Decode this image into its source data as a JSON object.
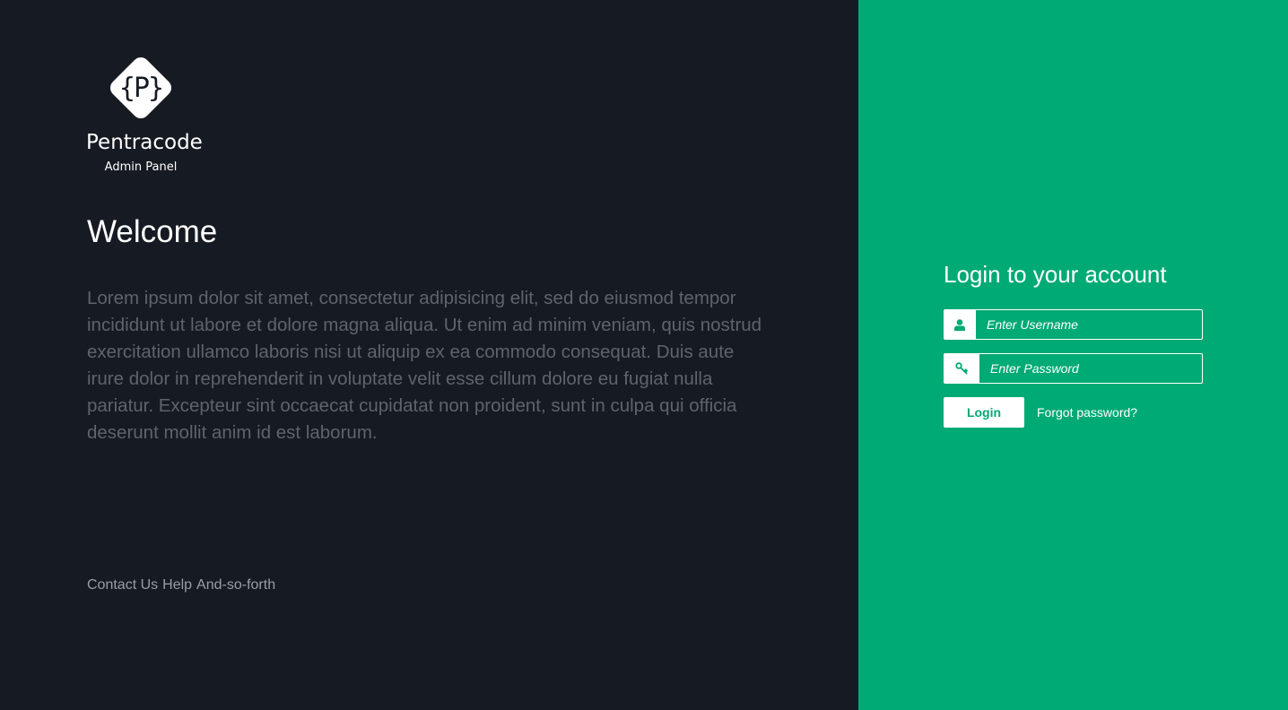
{
  "brand": {
    "logo_letter": "{P}",
    "name": "Pentracode",
    "subtitle": "Admin Panel"
  },
  "intro": {
    "heading": "Welcome",
    "body": "Lorem ipsum dolor sit amet, consectetur adipisicing elit, sed do eiusmod tempor incididunt ut labore et dolore magna aliqua. Ut enim ad minim veniam, quis nostrud exercitation ullamco laboris nisi ut aliquip ex ea commodo consequat. Duis aute irure dolor in reprehenderit in voluptate velit esse cillum dolore eu fugiat nulla pariatur. Excepteur sint occaecat cupidatat non proident, sunt in culpa qui officia deserunt mollit anim id est laborum."
  },
  "footer": {
    "links": [
      "Contact Us",
      "Help",
      "And-so-forth"
    ]
  },
  "login": {
    "title": "Login to your account",
    "username": {
      "placeholder": "Enter Username",
      "value": "",
      "icon": "user-icon"
    },
    "password": {
      "placeholder": "Enter Password",
      "value": "",
      "icon": "key-icon"
    },
    "submit_label": "Login",
    "forgot_label": "Forgot password?"
  },
  "colors": {
    "left_bg": "#161a23",
    "accent": "#00aa74",
    "body_text": "#5f646b",
    "footer_text": "#9a9ea4"
  }
}
